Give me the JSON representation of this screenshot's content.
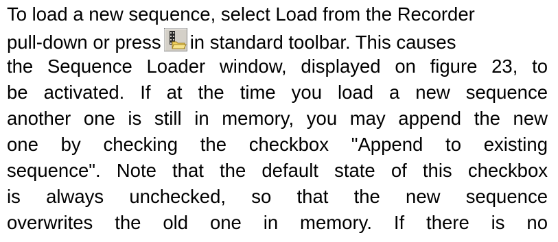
{
  "paragraph": {
    "line1": "To load a new sequence, select Load from the Recorder",
    "line2_before_icon": "pull-down or press",
    "line2_after_icon": "in standard toolbar. This causes",
    "line3": "the Sequence Loader window, displayed on figure 23, to",
    "line4": "be activated. If at the time you load a new sequence",
    "line5": "another one is still in memory, you may append the new",
    "line6": "one by checking the checkbox \"Append to existing",
    "line7": "sequence\". Note that the default state of this checkbox",
    "line8": "is always unchecked, so that the new sequence",
    "line9": "overwrites the old one in memory. If there is no"
  },
  "toolbar_icon": {
    "name": "load-sequence-icon",
    "colors": {
      "frame": "#808080",
      "face": "#d4d0c8",
      "film": "#2a2a2a",
      "folder": "#f0d060",
      "folder_edge": "#a08020"
    }
  }
}
